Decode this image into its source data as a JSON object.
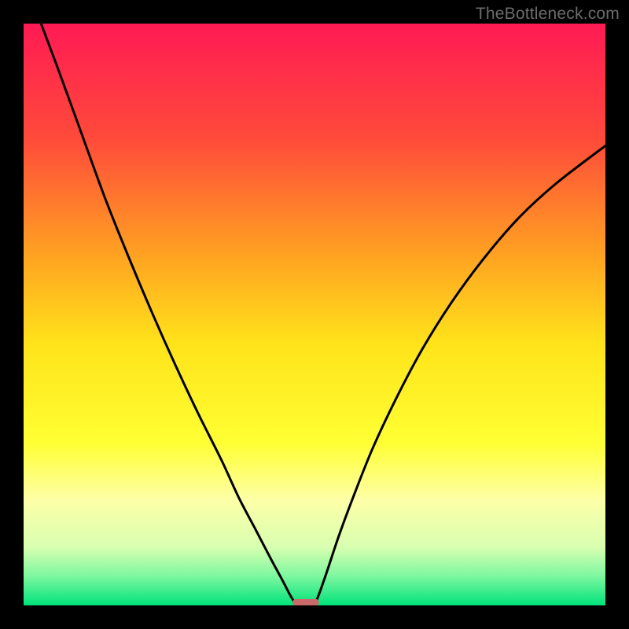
{
  "watermark": "TheBottleneck.com",
  "chart_data": {
    "type": "line",
    "title": "",
    "xlabel": "",
    "ylabel": "",
    "xlim": [
      0,
      100
    ],
    "ylim": [
      0,
      100
    ],
    "background_gradient_stops": [
      {
        "offset": 0.0,
        "color": "#ff1a54"
      },
      {
        "offset": 0.2,
        "color": "#ff4b3a"
      },
      {
        "offset": 0.4,
        "color": "#ffa321"
      },
      {
        "offset": 0.55,
        "color": "#ffe31a"
      },
      {
        "offset": 0.72,
        "color": "#ffff33"
      },
      {
        "offset": 0.82,
        "color": "#fdffa8"
      },
      {
        "offset": 0.9,
        "color": "#d8ffb0"
      },
      {
        "offset": 0.95,
        "color": "#7cf7a0"
      },
      {
        "offset": 1.0,
        "color": "#00e37a"
      }
    ],
    "series": [
      {
        "name": "left-branch",
        "x": [
          3,
          6,
          10,
          14,
          18,
          22,
          26,
          30,
          34,
          37,
          40,
          42.5,
          44.5,
          45.8,
          46.6,
          47.1
        ],
        "y": [
          100,
          92,
          81,
          70,
          60,
          50.5,
          41.5,
          33,
          25,
          18.5,
          12.8,
          8,
          4.3,
          1.8,
          0.5,
          0
        ]
      },
      {
        "name": "right-branch",
        "x": [
          50.0,
          50.8,
          52.2,
          54.2,
          56.8,
          60.0,
          64.0,
          68.5,
          73.5,
          79.0,
          85.0,
          91.5,
          100.0
        ],
        "y": [
          0,
          2.0,
          6.0,
          12.0,
          19.0,
          27.0,
          35.5,
          44.0,
          52.0,
          59.5,
          66.5,
          72.5,
          79.0
        ]
      }
    ],
    "marker": {
      "name": "bottleneck-marker",
      "x_center": 48.5,
      "width": 4.5,
      "y": 0.5,
      "height": 1.2,
      "color": "#c86a6a"
    }
  }
}
